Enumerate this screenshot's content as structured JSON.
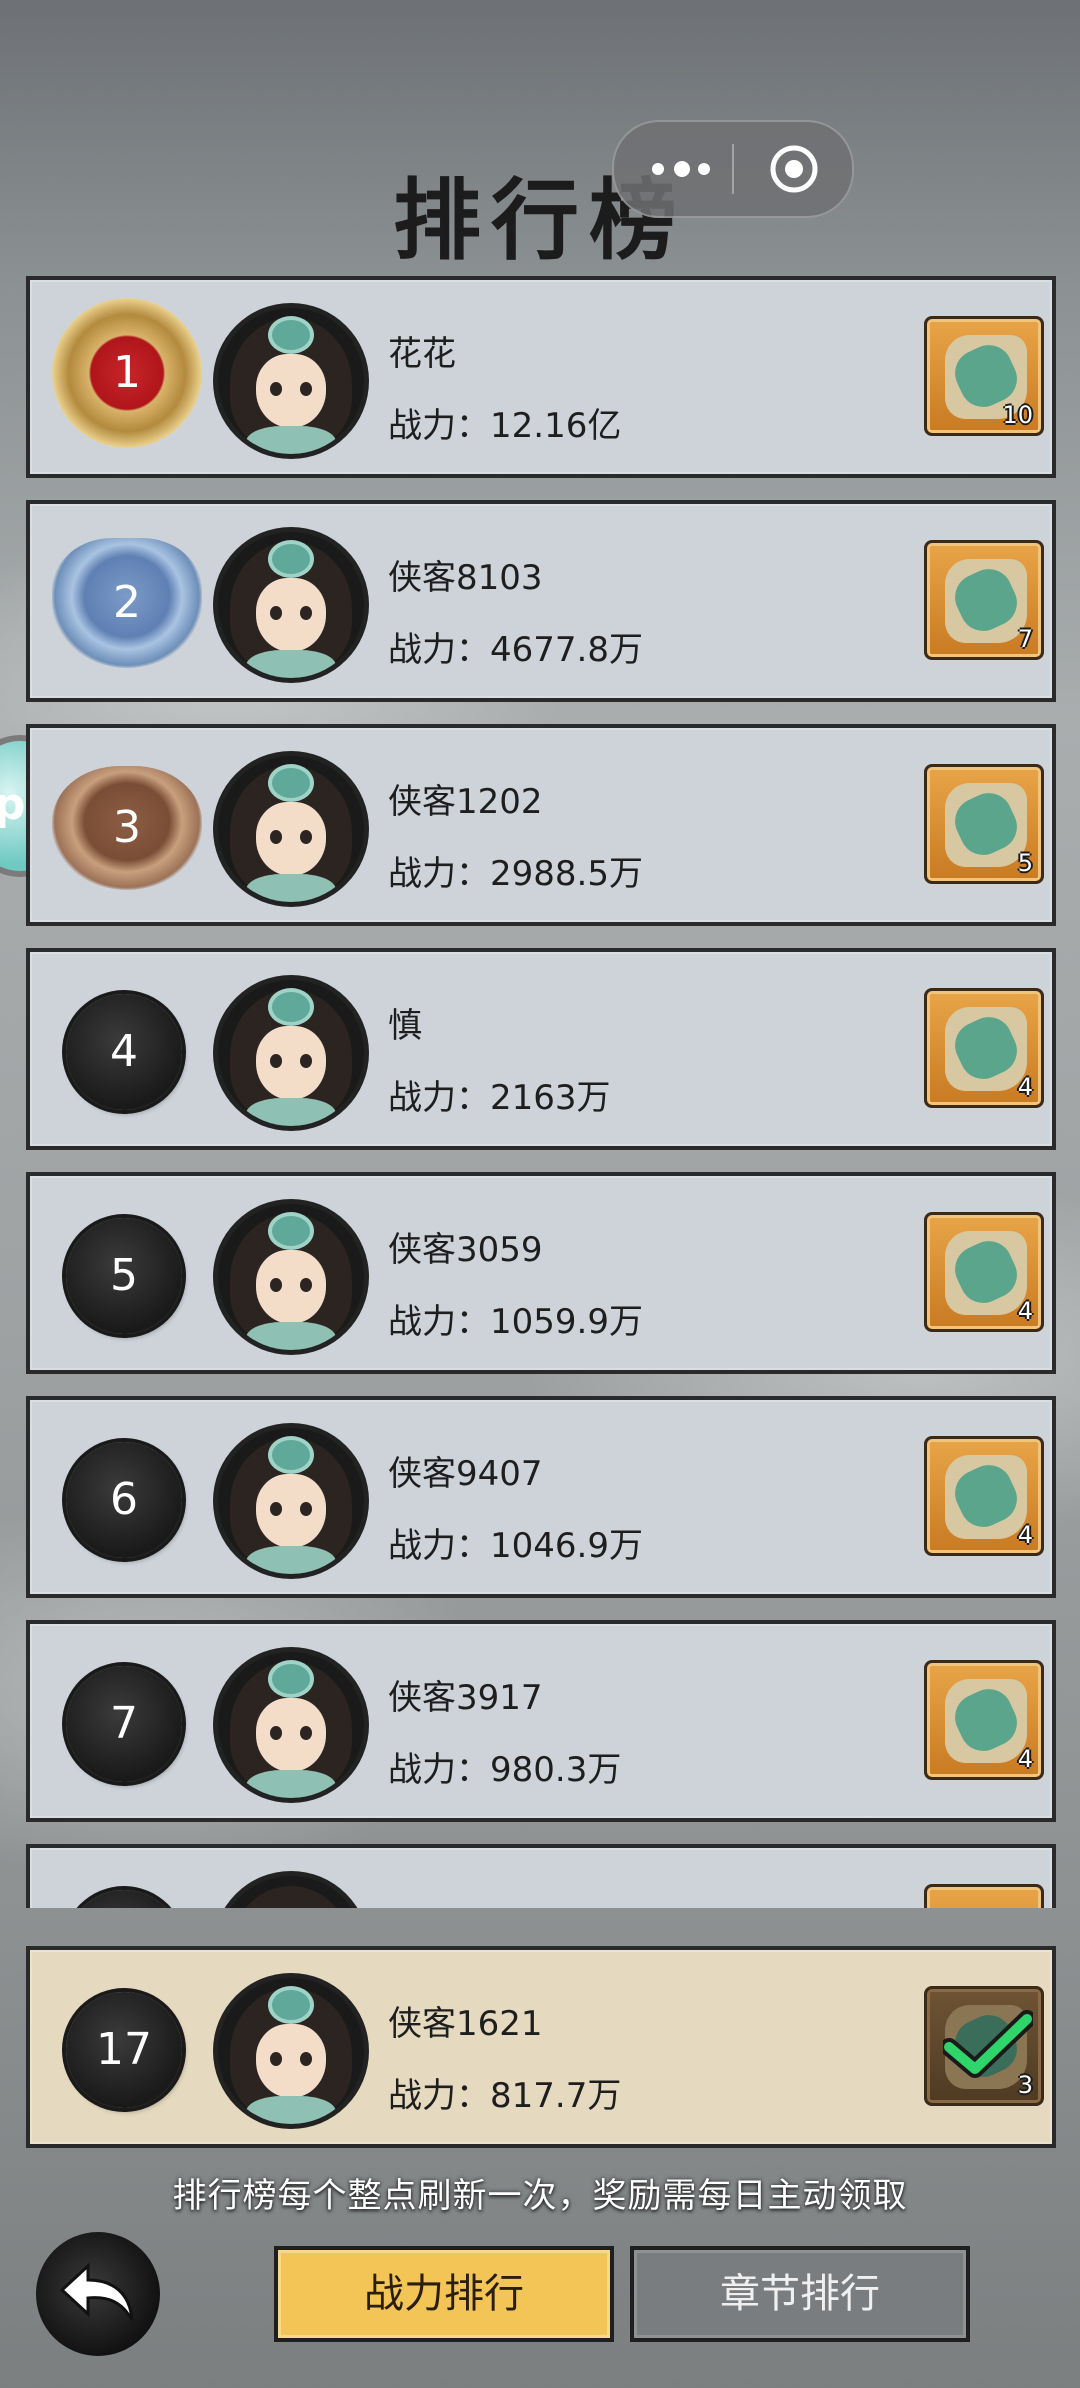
{
  "title": "排行榜",
  "rows": [
    {
      "rank": "1",
      "name": "花花",
      "power": "战力：12.16亿",
      "reward_count": "10",
      "style": "gold"
    },
    {
      "rank": "2",
      "name": "侠客8103",
      "power": "战力：4677.8万",
      "reward_count": "7",
      "style": "silver"
    },
    {
      "rank": "3",
      "name": "侠客1202",
      "power": "战力：2988.5万",
      "reward_count": "5",
      "style": "bronze"
    },
    {
      "rank": "4",
      "name": "慎",
      "power": "战力：2163万",
      "reward_count": "4",
      "style": "plain"
    },
    {
      "rank": "5",
      "name": "侠客3059",
      "power": "战力：1059.9万",
      "reward_count": "4",
      "style": "plain"
    },
    {
      "rank": "6",
      "name": "侠客9407",
      "power": "战力：1046.9万",
      "reward_count": "4",
      "style": "plain"
    },
    {
      "rank": "7",
      "name": "侠客3917",
      "power": "战力：980.3万",
      "reward_count": "4",
      "style": "plain"
    }
  ],
  "my_rank": {
    "rank": "17",
    "name": "侠客1621",
    "power": "战力：817.7万",
    "reward_count": "3",
    "claimed": true
  },
  "notice": "排行榜每个整点刷新一次，奖励需每日主动领取",
  "tabs": {
    "active": "战力排行",
    "inactive": "章节排行"
  },
  "side_bubble": "p",
  "icons": {
    "more": "more-dots-icon",
    "close": "target-circle-icon",
    "back": "back-arrow-icon",
    "check": "check-icon"
  },
  "colors": {
    "accent": "#f3c456",
    "row_bg": "#cdd3d9",
    "my_row_bg": "#e5d9bf",
    "check": "#2fd46a"
  }
}
